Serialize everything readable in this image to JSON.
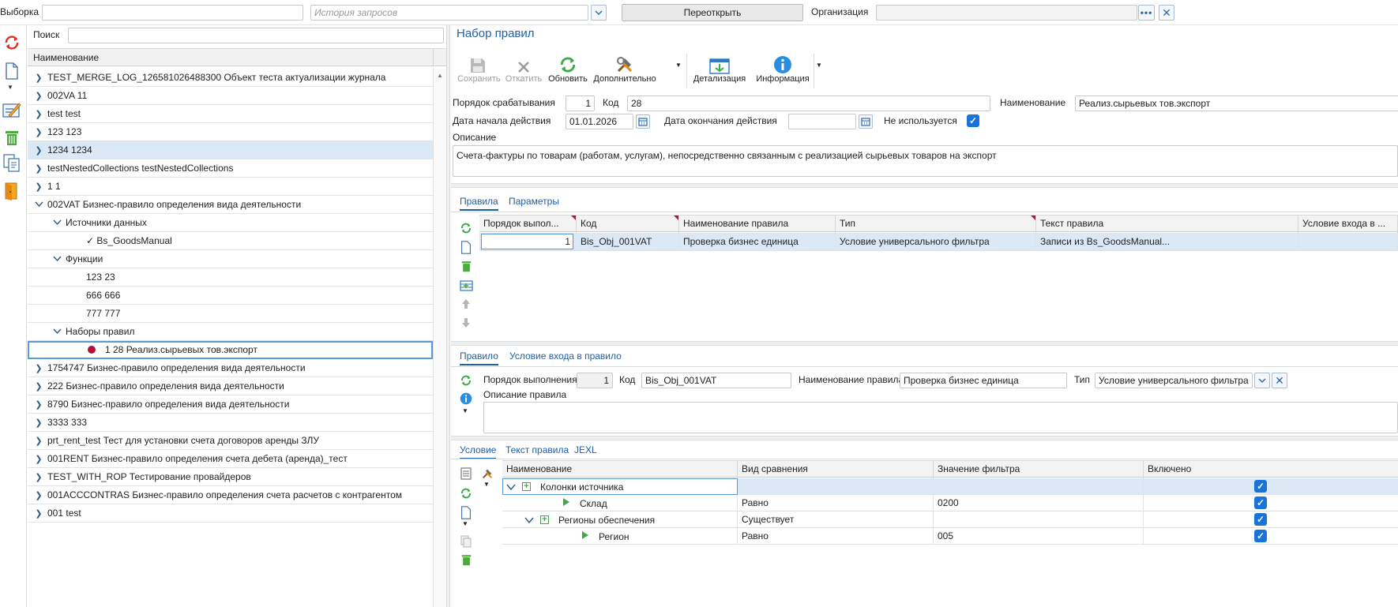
{
  "topbar": {
    "selection_label": "Выборка",
    "selection_value": "",
    "history_placeholder": "История запросов",
    "reopen_label": "Переоткрыть",
    "org_label": "Организация",
    "org_value": ""
  },
  "tree": {
    "search_label": "Поиск",
    "search_value": "",
    "column_header": "Наименование",
    "rows": [
      {
        "text": "TEST_MERGE_LOG_126581026488300 Объект теста актуализации журнала",
        "level": 0,
        "chev": "right"
      },
      {
        "text": "002VA 11",
        "level": 0,
        "chev": "right"
      },
      {
        "text": "test test",
        "level": 0,
        "chev": "right"
      },
      {
        "text": "123 123",
        "level": 0,
        "chev": "right"
      },
      {
        "text": "1234 1234",
        "level": 0,
        "chev": "right",
        "selected": true
      },
      {
        "text": "testNestedCollections testNestedCollections",
        "level": 0,
        "chev": "right"
      },
      {
        "text": "1 1",
        "level": 0,
        "chev": "right"
      },
      {
        "text": "002VAT Бизнес-правило определения вида деятельности",
        "level": 0,
        "chev": "down"
      },
      {
        "text": "Источники данных",
        "level": 1,
        "chev": "down"
      },
      {
        "text": "✓ Bs_GoodsManual",
        "level": 2,
        "chev": ""
      },
      {
        "text": "Функции",
        "level": 1,
        "chev": "down"
      },
      {
        "text": "123 23",
        "level": 2,
        "chev": ""
      },
      {
        "text": "666 666",
        "level": 2,
        "chev": ""
      },
      {
        "text": "777 777",
        "level": 2,
        "chev": ""
      },
      {
        "text": "Наборы правил",
        "level": 1,
        "chev": "down"
      },
      {
        "text": "1 28 Реализ.сырьевых тов.экспорт",
        "level": 2,
        "chev": "",
        "focused": true,
        "dot": true
      },
      {
        "text": "1754747 Бизнес-правило определения вида деятельности",
        "level": 0,
        "chev": "right"
      },
      {
        "text": "222 Бизнес-правило определения вида деятельности",
        "level": 0,
        "chev": "right"
      },
      {
        "text": "8790 Бизнес-правило определения вида деятельности",
        "level": 0,
        "chev": "right"
      },
      {
        "text": "3333 333",
        "level": 0,
        "chev": "right"
      },
      {
        "text": "prt_rent_test Тест для установки счета договоров аренды ЗЛУ",
        "level": 0,
        "chev": "right"
      },
      {
        "text": "001RENT Бизнес-правило определения счета дебета (аренда)_тест",
        "level": 0,
        "chev": "right"
      },
      {
        "text": "TEST_WITH_ROP Тестирование провайдеров",
        "level": 0,
        "chev": "right"
      },
      {
        "text": "001ACCCONTRAS Бизнес-правило определения счета расчетов с контрагентом",
        "level": 0,
        "chev": "right"
      },
      {
        "text": "001 test",
        "level": 0,
        "chev": "right"
      }
    ]
  },
  "ruleset": {
    "title": "Набор правил",
    "toolbar": {
      "save": "Сохранить",
      "rollback": "Откатить",
      "refresh": "Обновить",
      "more": "Дополнительно",
      "detail": "Детализация",
      "info": "Информация"
    },
    "order_label": "Порядок срабатывания",
    "order_value": "1",
    "code_label": "Код",
    "code_value": "28",
    "name_label": "Наименование",
    "name_value": "Реализ.сырьевых тов.экспорт",
    "start_label": "Дата начала действия",
    "start_value": "01.01.2026",
    "end_label": "Дата окончания действия",
    "end_value": "",
    "unused_label": "Не используется",
    "unused_checked": true,
    "desc_label": "Описание",
    "desc_value": "Счета-фактуры по товарам (работам, услугам), непосредственно связанным с реализацией сырьевых товаров на экспорт"
  },
  "rules_tabs": [
    "Правила",
    "Параметры"
  ],
  "rules_grid": {
    "headers": [
      "Порядок выпол...",
      "Код",
      "Наименование правила",
      "Тип",
      "Текст правила",
      "Условие входа в ..."
    ],
    "rows": [
      [
        "1",
        "Bis_Obj_001VAT",
        "Проверка бизнес единица",
        "Условие универсального фильтра",
        "Записи из Bs_GoodsManual...",
        ""
      ]
    ]
  },
  "rule_tabs": [
    "Правило",
    "Условие входа в правило"
  ],
  "rule": {
    "order_label": "Порядок выполнения",
    "order_value": "1",
    "code_label": "Код",
    "code_value": "Bis_Obj_001VAT",
    "name_label": "Наименование правила",
    "name_value": "Проверка бизнес единица",
    "type_label": "Тип",
    "type_value": "Условие универсального фильтра",
    "desc_label": "Описание правила",
    "desc_value": ""
  },
  "cond_tabs": [
    "Условие",
    "Текст правила",
    "JEXL"
  ],
  "cond_grid": {
    "headers": [
      "Наименование",
      "Вид сравнения",
      "Значение фильтра",
      "Включено"
    ],
    "rows": [
      {
        "name": "Колонки источника",
        "cmp": "",
        "val": "",
        "on": true,
        "level": 0,
        "kind": "group",
        "expand": "down"
      },
      {
        "name": "Склад",
        "cmp": "Равно",
        "val": "0200",
        "on": true,
        "level": 1,
        "kind": "leaf"
      },
      {
        "name": "Регионы обеспечения",
        "cmp": "Существует",
        "val": "",
        "on": true,
        "level": 1,
        "kind": "group",
        "expand": "down"
      },
      {
        "name": "Регион",
        "cmp": "Равно",
        "val": "005",
        "on": true,
        "level": 2,
        "kind": "leaf"
      }
    ]
  },
  "colors": {
    "accent": "#1f5fa6",
    "check": "#1a73d9",
    "selected_row": "#dbe8f6",
    "required_marker": "#a0203a"
  }
}
